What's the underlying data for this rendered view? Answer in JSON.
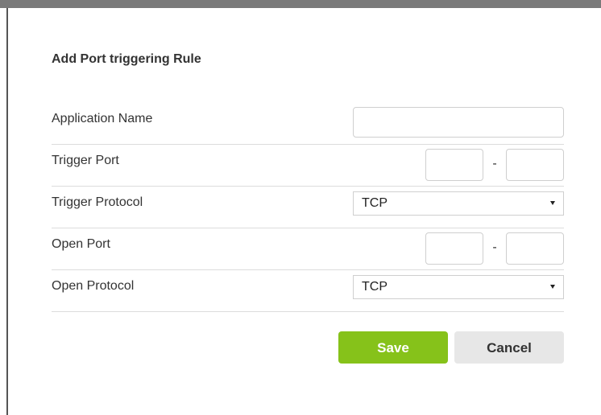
{
  "dialog": {
    "title": "Add Port triggering Rule"
  },
  "form": {
    "application_name": {
      "label": "Application Name",
      "value": ""
    },
    "trigger_port": {
      "label": "Trigger Port",
      "start": "",
      "end": "",
      "separator": "-"
    },
    "trigger_protocol": {
      "label": "Trigger Protocol",
      "selected": "TCP"
    },
    "open_port": {
      "label": "Open Port",
      "start": "",
      "end": "",
      "separator": "-"
    },
    "open_protocol": {
      "label": "Open Protocol",
      "selected": "TCP"
    }
  },
  "buttons": {
    "save_label": "Save",
    "cancel_label": "Cancel"
  },
  "colors": {
    "save": "#86c21a",
    "cancel": "#e7e7e7"
  }
}
